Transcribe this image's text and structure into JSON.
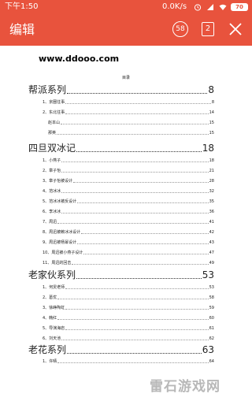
{
  "status_bar": {
    "time": "下午1:50",
    "network_speed": "0.0K/s",
    "battery": "70",
    "icons": [
      "alarm-icon",
      "signal-icon",
      "wifi-icon",
      "battery-icon"
    ]
  },
  "toolbar": {
    "title": "编辑",
    "circle_badge": "58",
    "square_badge": "2",
    "close_icon": "close-icon",
    "background": "#e8533d"
  },
  "document": {
    "site": "www.ddooo.com",
    "toc_heading": "目录",
    "sections": [
      {
        "title": "帮派系列",
        "page": "8",
        "items": [
          {
            "label": "1、京圈往事",
            "page": "8"
          },
          {
            "label": "2、东北往事",
            "page": "14"
          },
          {
            "label": "赵本山",
            "page": "15"
          },
          {
            "label": "那英",
            "page": "15"
          }
        ]
      },
      {
        "title": "四旦双冰记",
        "page": "18",
        "items": [
          {
            "label": "1、小燕子",
            "page": "18"
          },
          {
            "label": "2、章子怡",
            "page": "21"
          },
          {
            "label": "3、章子怡被设计",
            "page": "28"
          },
          {
            "label": "4、范冰冰",
            "page": "32"
          },
          {
            "label": "5、范冰冰被反设计",
            "page": "35"
          },
          {
            "label": "6、李冰冰",
            "page": "36"
          },
          {
            "label": "7、周迅",
            "page": "41"
          },
          {
            "label": "8、周迅被赖冰冰设计",
            "page": "42"
          },
          {
            "label": "9、周迅被杨幂设计",
            "page": "43"
          },
          {
            "label": "10、周迅被小燕子设计",
            "page": "47"
          },
          {
            "label": "11、周迅的回击",
            "page": "49"
          }
        ]
      },
      {
        "title": "老家伙系列",
        "page": "53",
        "items": [
          {
            "label": "1、何炅老师",
            "page": "53"
          },
          {
            "label": "2、葛优",
            "page": "58"
          },
          {
            "label": "3、徐峥陶虹",
            "page": "59"
          },
          {
            "label": "4、韩红",
            "page": "60"
          },
          {
            "label": "5、导演海岩",
            "page": "61"
          },
          {
            "label": "6、刘天池",
            "page": "62"
          }
        ]
      },
      {
        "title": "老花系列",
        "page": "63",
        "items": [
          {
            "label": "1、许晴",
            "page": "64"
          }
        ]
      }
    ]
  },
  "watermark": "雷石游戏网"
}
